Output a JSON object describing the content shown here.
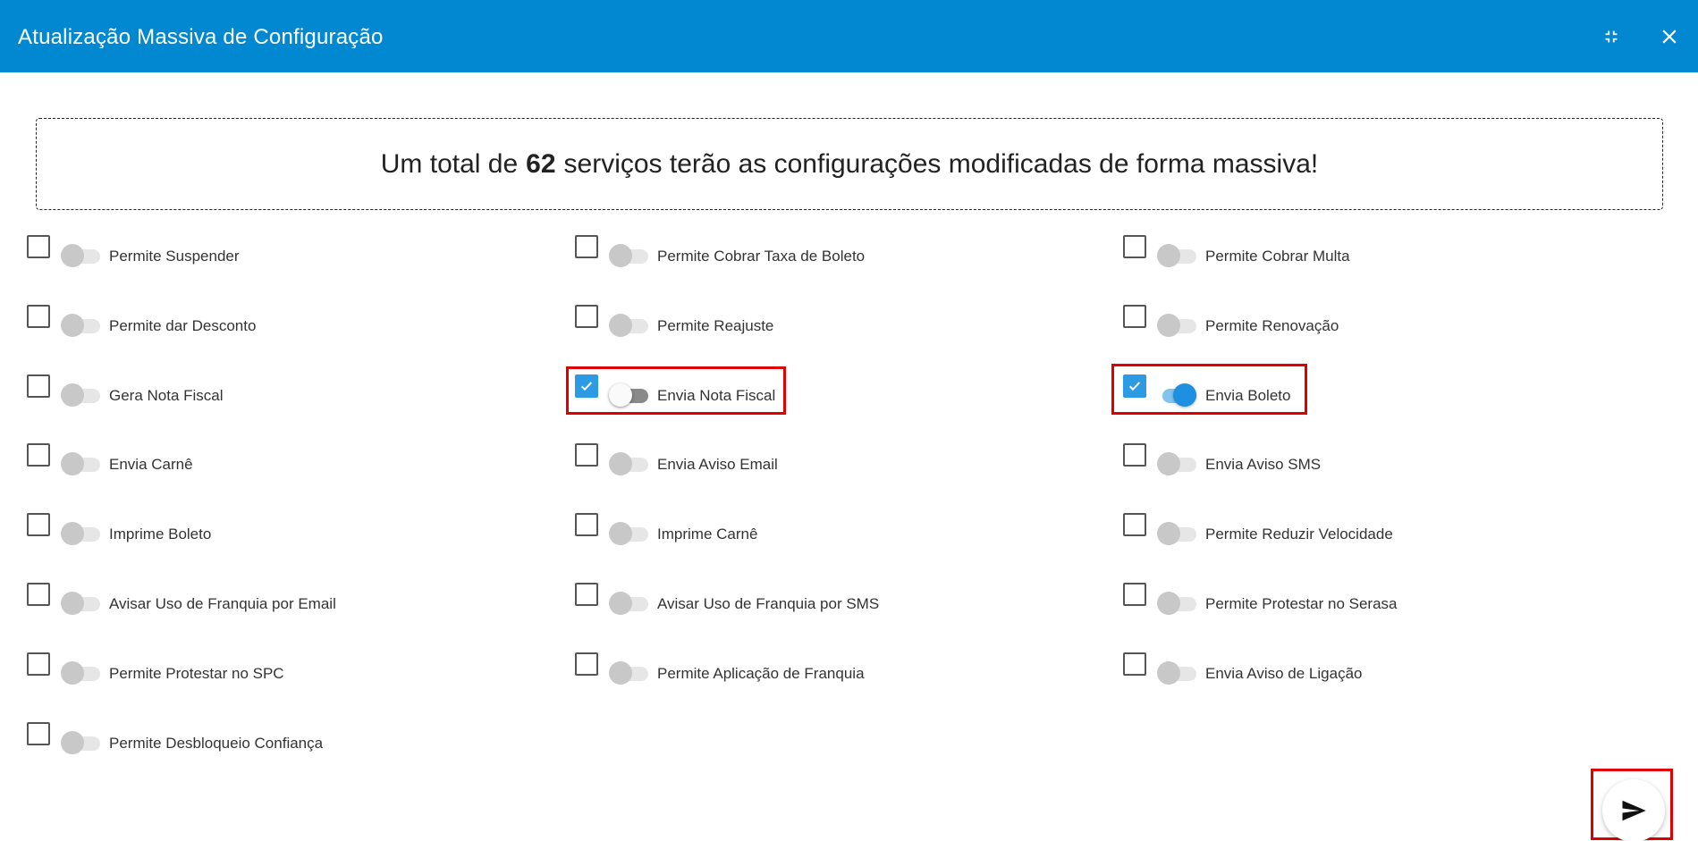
{
  "window": {
    "title": "Atualização Massiva de Configuração",
    "minimize_icon": "fullscreen-exit-icon",
    "close_icon": "close-icon"
  },
  "colors": {
    "header_bg": "#0288d1",
    "checkbox_checked": "#2c9be4",
    "switch_on": "#1e8fe1",
    "highlight": "#e00000"
  },
  "info": {
    "prefix": "Um total de",
    "count": "62",
    "suffix": "serviços terão as configurações modificadas de forma massiva!"
  },
  "options": [
    {
      "label": "Permite Suspender",
      "checked": false,
      "on": false
    },
    {
      "label": "Permite Cobrar Taxa de Boleto",
      "checked": false,
      "on": false
    },
    {
      "label": "Permite Cobrar Multa",
      "checked": false,
      "on": false
    },
    {
      "label": "Permite dar Desconto",
      "checked": false,
      "on": false
    },
    {
      "label": "Permite Reajuste",
      "checked": false,
      "on": false
    },
    {
      "label": "Permite Renovação",
      "checked": false,
      "on": false
    },
    {
      "label": "Gera Nota Fiscal",
      "checked": false,
      "on": false
    },
    {
      "label": "Envia Nota Fiscal",
      "checked": true,
      "on": false
    },
    {
      "label": "Envia Boleto",
      "checked": true,
      "on": true
    },
    {
      "label": "Envia Carnê",
      "checked": false,
      "on": false
    },
    {
      "label": "Envia Aviso Email",
      "checked": false,
      "on": false
    },
    {
      "label": "Envia Aviso SMS",
      "checked": false,
      "on": false
    },
    {
      "label": "Imprime Boleto",
      "checked": false,
      "on": false
    },
    {
      "label": "Imprime Carnê",
      "checked": false,
      "on": false
    },
    {
      "label": "Permite Reduzir Velocidade",
      "checked": false,
      "on": false
    },
    {
      "label": "Avisar Uso de Franquia por Email",
      "checked": false,
      "on": false
    },
    {
      "label": "Avisar Uso de Franquia por SMS",
      "checked": false,
      "on": false
    },
    {
      "label": "Permite Protestar no Serasa",
      "checked": false,
      "on": false
    },
    {
      "label": "Permite Protestar no SPC",
      "checked": false,
      "on": false
    },
    {
      "label": "Permite Aplicação de Franquia",
      "checked": false,
      "on": false
    },
    {
      "label": "Envia Aviso de Ligação",
      "checked": false,
      "on": false
    },
    {
      "label": "Permite Desbloqueio Confiança",
      "checked": false,
      "on": false
    }
  ],
  "send_button": {
    "icon": "send-icon"
  }
}
